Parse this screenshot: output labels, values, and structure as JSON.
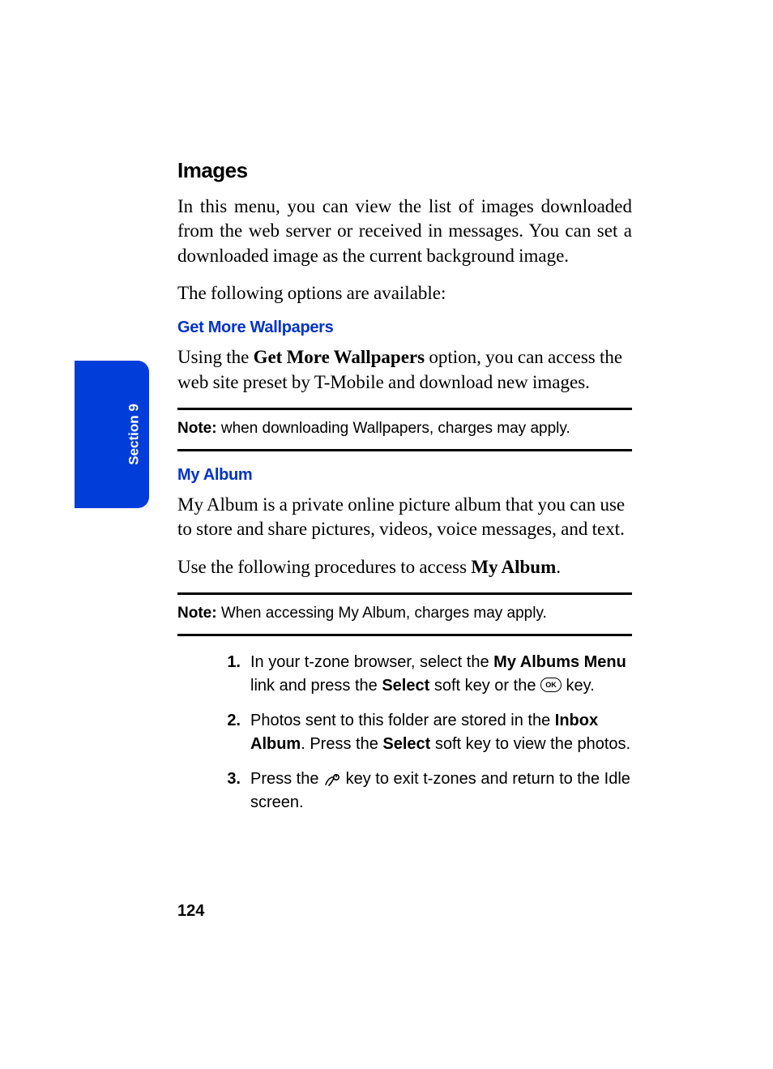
{
  "sectionTab": "Section 9",
  "pageNumber": "124",
  "heading": "Images",
  "intro1": "In this menu, you can view the list of images downloaded from the web server or received in messages. You can set a downloaded image as the current background image.",
  "intro2": "The following options are available:",
  "sub1": "Get More Wallpapers",
  "getMore": {
    "pre": "Using the ",
    "bold": "Get More Wallpapers",
    "post": " option, you can access the web site preset by T-Mobile and download new images."
  },
  "note1_label": "Note:",
  "note1_body": " when downloading Wallpapers, charges may apply.",
  "sub2": "My Album",
  "myAlbum1": "My Album is a private online picture album that you can use to store and share pictures, videos, voice messages, and text.",
  "myAlbum2_pre": "Use the following procedures to access ",
  "myAlbum2_bold": "My Album",
  "myAlbum2_post": ".",
  "note2_label": "Note:",
  "note2_body": " When accessing My Album, charges may apply.",
  "steps": {
    "n1": "1.",
    "s1_1": "In your t-zone browser, select the ",
    "s1_b1": "My Albums Menu",
    "s1_2": " link and press the ",
    "s1_b2": "Select",
    "s1_3": " soft key or the ",
    "s1_ok": "OK",
    "s1_4": " key.",
    "n2": "2.",
    "s2_1": "Photos sent to this folder are stored in the ",
    "s2_b1": "Inbox Album",
    "s2_2": ". Press the ",
    "s2_b2": "Select",
    "s2_3": " soft key to view the photos.",
    "n3": "3.",
    "s3_1": "Press the ",
    "s3_2": " key to exit t-zones and return to the Idle screen."
  }
}
